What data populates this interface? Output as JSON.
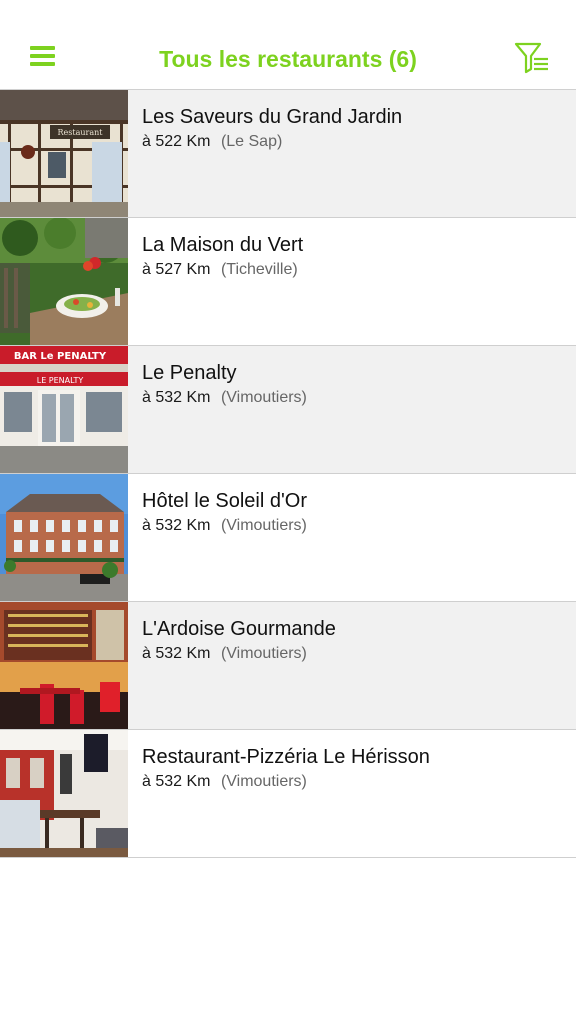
{
  "header": {
    "title": "Tous les restaurants (6)",
    "menu_icon": "hamburger-menu-icon",
    "filter_icon": "filter-list-icon",
    "accent_color": "#7dd21f"
  },
  "restaurants": [
    {
      "name": "Les Saveurs du Grand Jardin",
      "distance": "à 522 Km",
      "city": "(Le Sap)",
      "photo_sign": "Restaurant"
    },
    {
      "name": "La Maison du Vert",
      "distance": "à 527 Km",
      "city": "(Ticheville)"
    },
    {
      "name": "Le Penalty",
      "distance": "à 532 Km",
      "city": "(Vimoutiers)",
      "photo_sign": "BAR Le PENALTY",
      "photo_sign2": "LE PENALTY"
    },
    {
      "name": "Hôtel le Soleil d'Or",
      "distance": "à 532 Km",
      "city": "(Vimoutiers)"
    },
    {
      "name": "L'Ardoise Gourmande",
      "distance": "à 532 Km",
      "city": "(Vimoutiers)"
    },
    {
      "name": "Restaurant-Pizzéria Le Hérisson",
      "distance": "à 532 Km",
      "city": "(Vimoutiers)"
    }
  ]
}
